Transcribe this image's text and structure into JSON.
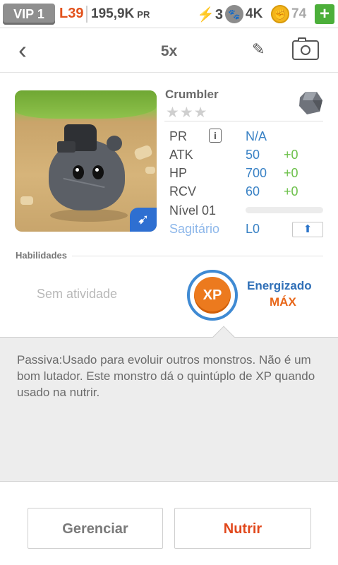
{
  "status_bar": {
    "vip_label": "VIP 1",
    "level": "L39",
    "power_total": "195,9K",
    "power_unit": "PR",
    "energy": "3",
    "paws": "4K",
    "coins": "74",
    "add_label": "+"
  },
  "header": {
    "title": "5x"
  },
  "monster": {
    "name": "Crumbler",
    "stars_text": "★★★",
    "stats": {
      "pr": {
        "label": "PR",
        "value": "N/A"
      },
      "atk": {
        "label": "ATK",
        "value": "50",
        "bonus": "+0"
      },
      "hp": {
        "label": "HP",
        "value": "700",
        "bonus": "+0"
      },
      "rcv": {
        "label": "RCV",
        "value": "60",
        "bonus": "+0"
      },
      "level": {
        "label": "Nível 01",
        "progress": 0.0
      },
      "sign": {
        "label": "Sagitário",
        "value": "L0"
      }
    },
    "info_label": "i"
  },
  "abilities": {
    "heading": "Habilidades",
    "activity": "Sem atividade",
    "xp_icon_text": "XP",
    "boost_title": "Energizado",
    "boost_level": "MÁX"
  },
  "description": "Passiva:Usado para evoluir outros monstros. Não é um bom lutador. Este monstro dá o quintúplo de XP quando usado na nutrir.",
  "actions": {
    "manage": "Gerenciar",
    "feed": "Nutrir"
  },
  "colors": {
    "accent_blue": "#3a82c5",
    "accent_orange": "#e8671a",
    "bonus_green": "#6cc04a"
  }
}
